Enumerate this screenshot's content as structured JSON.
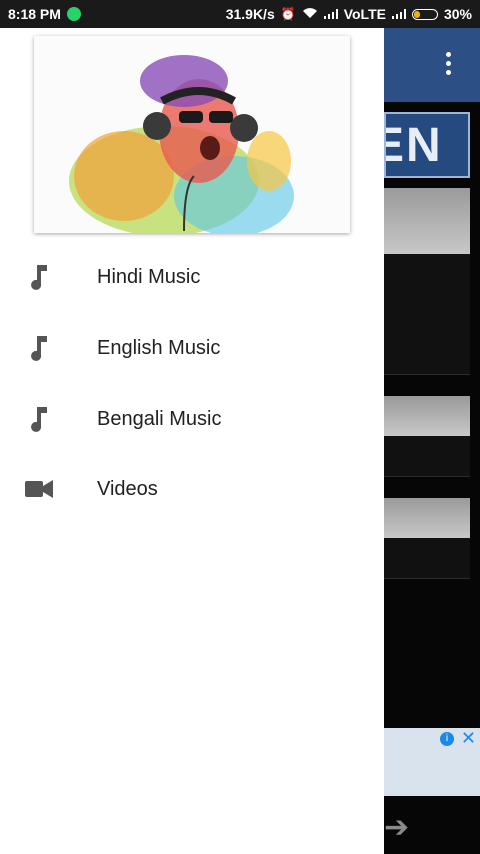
{
  "status_bar": {
    "time": "8:18 PM",
    "network_speed": "31.9K/s",
    "carrier": "VoLTE",
    "battery": "30%",
    "battery_level": 0.3
  },
  "drawer": {
    "menu": [
      {
        "label": "Hindi Music",
        "icon": "music-note-icon"
      },
      {
        "label": "English Music",
        "icon": "music-note-icon"
      },
      {
        "label": "Bengali Music",
        "icon": "music-note-icon"
      },
      {
        "label": "Videos",
        "icon": "videocam-icon"
      }
    ]
  },
  "background_app": {
    "banner_text": "EN",
    "toolbar_color": "#2c4f86"
  },
  "colors": {
    "drawer_bg": "#ffffff",
    "icon": "#555555",
    "text": "#212121"
  }
}
